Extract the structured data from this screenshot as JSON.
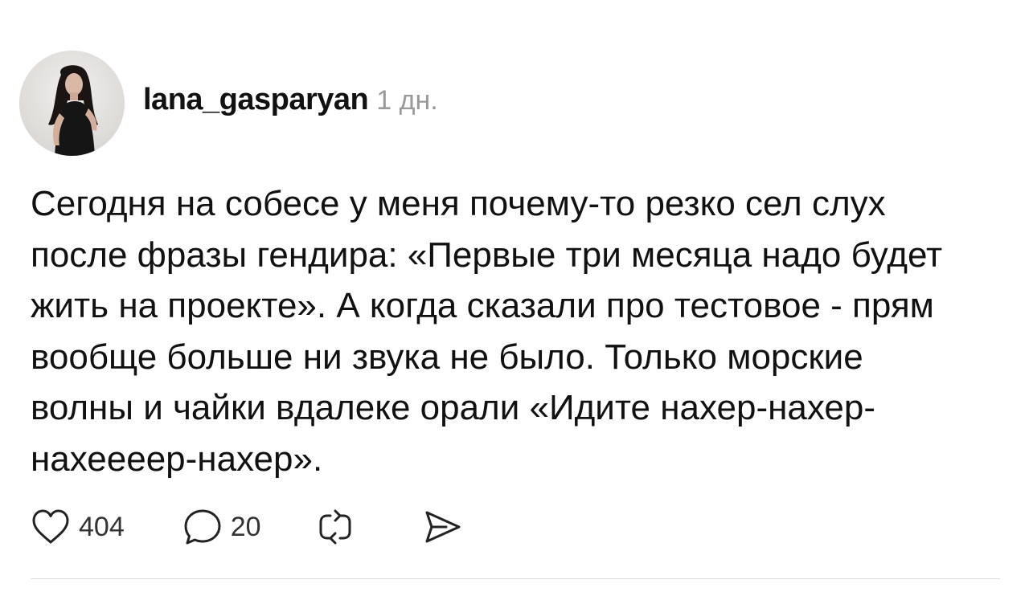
{
  "post": {
    "author": {
      "username": "lana_gasparyan",
      "avatar_alt": "avatar"
    },
    "timestamp": "1 дн.",
    "text_lines": [
      "Сегодня на собесе у меня почему-то резко сел слух",
      "после фразы гендира: «Первые три месяца надо будет",
      "жить на проекте». А когда сказали про тестовое - прям",
      "вообще больше ни звука не было. Только морские",
      "волны и чайки вдалеке орали «Идите нахер-нахер-",
      "нахеееер-нахер»."
    ],
    "actions": {
      "likes": "404",
      "replies": "20",
      "like_icon": "heart-icon",
      "reply_icon": "speech-bubble-icon",
      "repost_icon": "repost-icon",
      "share_icon": "send-icon"
    }
  },
  "colors": {
    "text": "#111111",
    "muted": "#9a9a9a",
    "icon": "#222222",
    "divider": "#dcdcdc"
  }
}
